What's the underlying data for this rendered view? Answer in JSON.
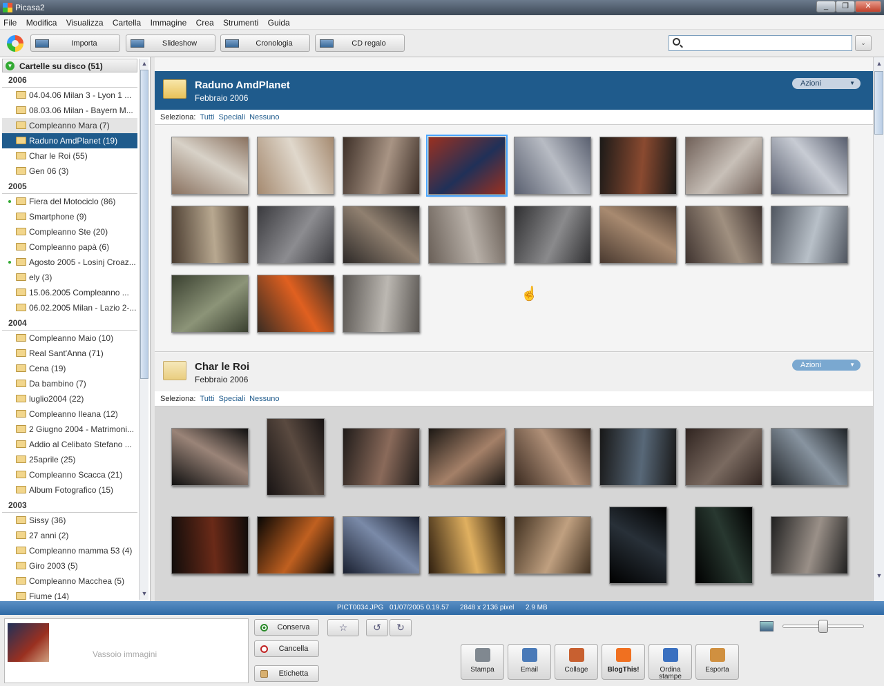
{
  "window": {
    "title": "Picasa2",
    "controls": [
      "_",
      "❐",
      "✕"
    ]
  },
  "menu": [
    "File",
    "Modifica",
    "Visualizza",
    "Cartella",
    "Immagine",
    "Crea",
    "Strumenti",
    "Guida"
  ],
  "toolbar": {
    "buttons": [
      {
        "label": "Importa",
        "icon": "camera-import-icon"
      },
      {
        "label": "Slideshow",
        "icon": "slideshow-icon"
      },
      {
        "label": "Cronologia",
        "icon": "timeline-icon"
      },
      {
        "label": "CD regalo",
        "icon": "gift-cd-icon"
      }
    ],
    "search_value": "",
    "search_options_glyph": "⌄"
  },
  "sidebar": {
    "header": "Cartelle su disco (51)",
    "groups": [
      {
        "year": "2006",
        "items": [
          {
            "label": "04.04.06 Milan 3 - Lyon 1 ...",
            "state": ""
          },
          {
            "label": "08.03.06 Milan - Bayern M...",
            "state": ""
          },
          {
            "label": "Compleanno Mara (7)",
            "state": "hover"
          },
          {
            "label": "Raduno AmdPlanet (19)",
            "state": "selected"
          },
          {
            "label": "Char le Roi (55)",
            "state": ""
          },
          {
            "label": "Gen 06 (3)",
            "state": ""
          }
        ]
      },
      {
        "year": "2005",
        "items": [
          {
            "label": "Fiera del Motociclo (86)",
            "state": "",
            "dot": true
          },
          {
            "label": "Smartphone (9)",
            "state": ""
          },
          {
            "label": "Compleanno Ste (20)",
            "state": ""
          },
          {
            "label": "Compleanno papà (6)",
            "state": ""
          },
          {
            "label": "Agosto 2005 - Losinj Croaz...",
            "state": "",
            "dot": true
          },
          {
            "label": "ely (3)",
            "state": ""
          },
          {
            "label": "15.06.2005 Compleanno ...",
            "state": ""
          },
          {
            "label": "06.02.2005 Milan - Lazio 2-...",
            "state": ""
          }
        ]
      },
      {
        "year": "2004",
        "items": [
          {
            "label": "Compleanno Maio (10)",
            "state": ""
          },
          {
            "label": "Real Sant'Anna (71)",
            "state": ""
          },
          {
            "label": "Cena (19)",
            "state": ""
          },
          {
            "label": "Da bambino (7)",
            "state": ""
          },
          {
            "label": "luglio2004 (22)",
            "state": ""
          },
          {
            "label": "Compleanno Ileana (12)",
            "state": ""
          },
          {
            "label": "2 Giugno 2004 - Matrimoni...",
            "state": ""
          },
          {
            "label": "Addio al Celibato Stefano ...",
            "state": ""
          },
          {
            "label": "25aprile (25)",
            "state": ""
          },
          {
            "label": "Compleanno Scacca (21)",
            "state": ""
          },
          {
            "label": "Album Fotografico (15)",
            "state": ""
          }
        ]
      },
      {
        "year": "2003",
        "items": [
          {
            "label": "Sissy (36)",
            "state": ""
          },
          {
            "label": "27 anni (2)",
            "state": ""
          },
          {
            "label": "Compleanno mamma 53 (4)",
            "state": ""
          },
          {
            "label": "Giro 2003 (5)",
            "state": ""
          },
          {
            "label": "Compleanno Macchea (5)",
            "state": ""
          },
          {
            "label": "Fiume (14)",
            "state": ""
          }
        ]
      }
    ]
  },
  "albums": [
    {
      "name": "Raduno AmdPlanet",
      "date": "Febbraio 2006",
      "actions_label": "Azioni",
      "select_label": "Seleziona:",
      "select_links": [
        "Tutti",
        "Speciali",
        "Nessuno"
      ],
      "selected_photo_index": 3,
      "photo_colors": [
        [
          "#8a7260",
          "#d8d2c8"
        ],
        [
          "#a58a70",
          "#e0d8cc"
        ],
        [
          "#3e3028",
          "#a89484"
        ],
        [
          "#9a3020",
          "#203058"
        ],
        [
          "#5a6070",
          "#b8bcc4"
        ],
        [
          "#1c1a18",
          "#8a4a30"
        ],
        [
          "#706058",
          "#c8c0b8"
        ],
        [
          "#585e6e",
          "#c8ccd4"
        ],
        [
          "#4a3c30",
          "#b8a890"
        ],
        [
          "#3a3a3e",
          "#8c8c90"
        ],
        [
          "#2e2a28",
          "#908070"
        ],
        [
          "#6a6058",
          "#b8b0a8"
        ],
        [
          "#303032",
          "#8a8a8c"
        ],
        [
          "#4a3a30",
          "#a88a70"
        ],
        [
          "#403430",
          "#a09080"
        ],
        [
          "#505660",
          "#b8c0c8"
        ],
        [
          "#3a4030",
          "#8c9478"
        ],
        [
          "#3a2c22",
          "#e06020"
        ],
        [
          "#5a5652",
          "#bcb8b2"
        ]
      ]
    },
    {
      "name": "Char le Roi",
      "date": "Febbraio 2006",
      "actions_label": "Azioni",
      "select_label": "Seleziona:",
      "select_links": [
        "Tutti",
        "Speciali",
        "Nessuno"
      ],
      "photo_colors": [
        [
          "#101010",
          "#9a8478"
        ],
        [
          "#181414",
          "#5a4a40"
        ],
        [
          "#201c1a",
          "#8a6a5a"
        ],
        [
          "#1c1814",
          "#a48068"
        ],
        [
          "#3a2a20",
          "#b09078"
        ],
        [
          "#181818",
          "#586878"
        ],
        [
          "#302420",
          "#7a6a60"
        ],
        [
          "#202428",
          "#8894a0"
        ],
        [
          "#100c0a",
          "#6a2a18"
        ],
        [
          "#080604",
          "#c06020"
        ],
        [
          "#1a2030",
          "#7a8aa8"
        ],
        [
          "#302010",
          "#e0b060"
        ],
        [
          "#403020",
          "#c0a080"
        ],
        [
          "#000000",
          "#283038"
        ],
        [
          "#000000",
          "#283830"
        ],
        [
          "#202020",
          "#9a9088"
        ],
        [
          "#141210",
          "#4a4038"
        ],
        [
          "#100e0c",
          "#3a3430"
        ],
        [
          "#181614",
          "#5a5048"
        ],
        [
          "#1a1816",
          "#6a6058"
        ],
        [
          "#121010",
          "#4a4440"
        ],
        [
          "#161414",
          "#585050"
        ],
        [
          "#141414",
          "#484848"
        ],
        [
          "#1a1a1a",
          "#5a5a5a"
        ]
      ]
    }
  ],
  "status": {
    "file": "PICT0034.JPG",
    "datetime": "01/07/2005 0.19.57",
    "dimensions": "2848 x 2136 pixel",
    "size": "2.9 MB"
  },
  "tray": {
    "label": "Vassoio immagini",
    "conserva": "Conserva",
    "cancella": "Cancella",
    "etichetta": "Etichetta",
    "star_glyph": "☆",
    "rotate_left_glyph": "↺",
    "rotate_right_glyph": "↻",
    "zoom_level": 0.5,
    "actions": [
      {
        "label": "Stampa",
        "icon": "printer-icon",
        "color": "#808890"
      },
      {
        "label": "Email",
        "icon": "email-icon",
        "color": "#4a7ab8"
      },
      {
        "label": "Collage",
        "icon": "collage-icon",
        "color": "#c86030"
      },
      {
        "label": "BlogThis!",
        "icon": "blogger-icon",
        "color": "#f07020"
      },
      {
        "label": "Ordina stampe",
        "icon": "order-prints-icon",
        "color": "#3a70c0"
      },
      {
        "label": "Esporta",
        "icon": "export-icon",
        "color": "#d09040"
      }
    ]
  }
}
